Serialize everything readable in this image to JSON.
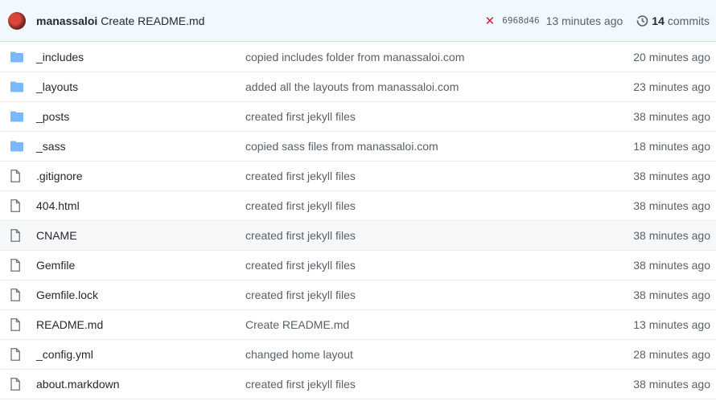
{
  "header": {
    "author": "manassaloi",
    "message": "Create README.md",
    "status_icon": "x-icon",
    "status_color": "#cb2431",
    "sha": "6968d46",
    "time": "13 minutes ago",
    "commits_count": "14",
    "commits_label": "commits"
  },
  "files": [
    {
      "type": "folder",
      "name": "_includes",
      "message": "copied includes folder from manassaloi.com",
      "age": "20 minutes ago"
    },
    {
      "type": "folder",
      "name": "_layouts",
      "message": "added all the layouts from manassaloi.com",
      "age": "23 minutes ago"
    },
    {
      "type": "folder",
      "name": "_posts",
      "message": "created first jekyll files",
      "age": "38 minutes ago"
    },
    {
      "type": "folder",
      "name": "_sass",
      "message": "copied sass files from manassaloi.com",
      "age": "18 minutes ago"
    },
    {
      "type": "file",
      "name": ".gitignore",
      "message": "created first jekyll files",
      "age": "38 minutes ago"
    },
    {
      "type": "file",
      "name": "404.html",
      "message": "created first jekyll files",
      "age": "38 minutes ago"
    },
    {
      "type": "file",
      "name": "CNAME",
      "message": "created first jekyll files",
      "age": "38 minutes ago"
    },
    {
      "type": "file",
      "name": "Gemfile",
      "message": "created first jekyll files",
      "age": "38 minutes ago"
    },
    {
      "type": "file",
      "name": "Gemfile.lock",
      "message": "created first jekyll files",
      "age": "38 minutes ago"
    },
    {
      "type": "file",
      "name": "README.md",
      "message": "Create README.md",
      "age": "13 minutes ago"
    },
    {
      "type": "file",
      "name": "_config.yml",
      "message": "changed home layout",
      "age": "28 minutes ago"
    },
    {
      "type": "file",
      "name": "about.markdown",
      "message": "created first jekyll files",
      "age": "38 minutes ago"
    }
  ],
  "colors": {
    "folder": "#79b8ff",
    "header_bg": "#f1f8ff"
  }
}
